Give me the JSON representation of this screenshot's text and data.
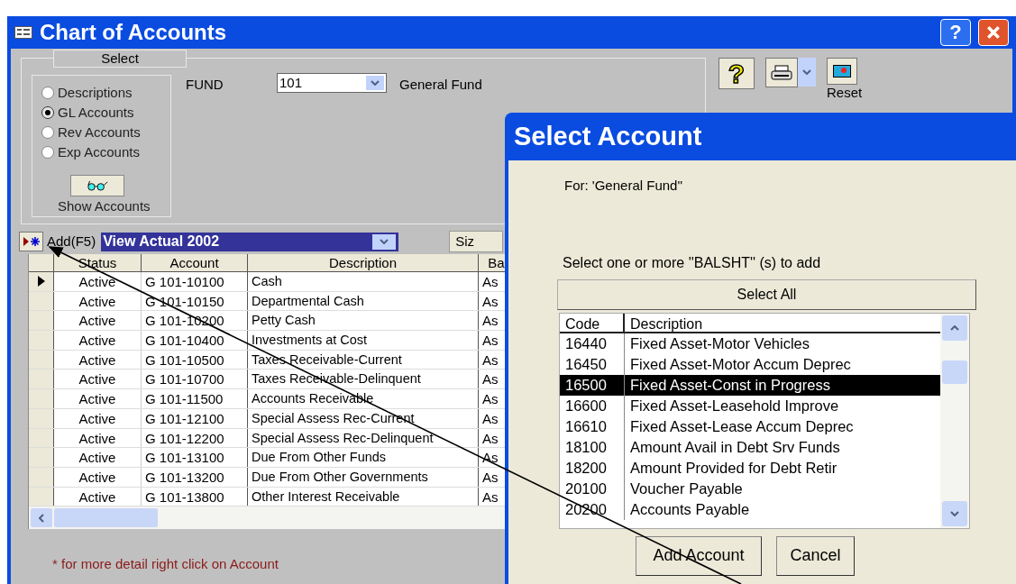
{
  "window": {
    "title": "Chart of Accounts",
    "help_glyph": "?"
  },
  "select_group": {
    "title": "Select",
    "options": [
      {
        "label": "Descriptions",
        "selected": false
      },
      {
        "label": "GL Accounts",
        "selected": true
      },
      {
        "label": "Rev Accounts",
        "selected": false
      },
      {
        "label": "Exp Accounts",
        "selected": false
      }
    ],
    "show_button": "Show Accounts"
  },
  "fund": {
    "label": "FUND",
    "value": "101",
    "name": "General Fund"
  },
  "toolbar": {
    "help_glyph": "?",
    "reset_label": "Reset"
  },
  "grid_bar": {
    "add_label": "Add(F5)",
    "view": "View Actual 2002",
    "size_button": "Siz"
  },
  "table": {
    "columns": [
      "Status",
      "Account",
      "Description",
      "Ba"
    ],
    "rows": [
      {
        "current": true,
        "status": "Active",
        "account": "G 101-10100",
        "description": "Cash",
        "column_4": "As"
      },
      {
        "current": false,
        "status": "Active",
        "account": "G 101-10150",
        "description": "Departmental Cash",
        "column_4": "As"
      },
      {
        "current": false,
        "status": "Active",
        "account": "G 101-10200",
        "description": "Petty Cash",
        "column_4": "As"
      },
      {
        "current": false,
        "status": "Active",
        "account": "G 101-10400",
        "description": "Investments at Cost",
        "column_4": "As"
      },
      {
        "current": false,
        "status": "Active",
        "account": "G 101-10500",
        "description": "Taxes Receivable-Current",
        "column_4": "As"
      },
      {
        "current": false,
        "status": "Active",
        "account": "G 101-10700",
        "description": "Taxes Receivable-Delinquent",
        "column_4": "As"
      },
      {
        "current": false,
        "status": "Active",
        "account": "G 101-11500",
        "description": "Accounts Receivable",
        "column_4": "As"
      },
      {
        "current": false,
        "status": "Active",
        "account": "G 101-12100",
        "description": "Special Assess Rec-Current",
        "column_4": "As"
      },
      {
        "current": false,
        "status": "Active",
        "account": "G 101-12200",
        "description": "Special Assess Rec-Delinquent",
        "column_4": "As"
      },
      {
        "current": false,
        "status": "Active",
        "account": "G 101-13100",
        "description": "Due From Other Funds",
        "column_4": "As"
      },
      {
        "current": false,
        "status": "Active",
        "account": "G 101-13200",
        "description": "Due From Other Governments",
        "column_4": "As"
      },
      {
        "current": false,
        "status": "Active",
        "account": "G 101-13800",
        "description": "Other Interest Receivable",
        "column_4": "As"
      }
    ]
  },
  "footnote": "* for more detail right click on Account",
  "dialog": {
    "title": "Select Account",
    "for_text": "For: 'General Fund''",
    "instruction": "Select one or more ''BALSHT'' (s) to add",
    "select_all": "Select All",
    "columns": [
      "Code",
      "Description"
    ],
    "items": [
      {
        "code": "16440",
        "description": "Fixed Asset-Motor Vehicles",
        "selected": false
      },
      {
        "code": "16450",
        "description": "Fixed Asset-Motor Accum Deprec",
        "selected": false
      },
      {
        "code": "16500",
        "description": "Fixed Asset-Const in Progress",
        "selected": true
      },
      {
        "code": "16600",
        "description": "Fixed Asset-Leasehold Improve",
        "selected": false
      },
      {
        "code": "16610",
        "description": "Fixed Asset-Lease Accum Deprec",
        "selected": false
      },
      {
        "code": "18100",
        "description": "Amount Avail in Debt Srv Funds",
        "selected": false
      },
      {
        "code": "18200",
        "description": "Amount Provided for Debt Retir",
        "selected": false
      },
      {
        "code": "20100",
        "description": "Voucher Payable",
        "selected": false
      },
      {
        "code": "20200",
        "description": "Accounts Payable",
        "selected": false
      }
    ],
    "buttons": [
      "Add Account",
      "Cancel"
    ]
  }
}
